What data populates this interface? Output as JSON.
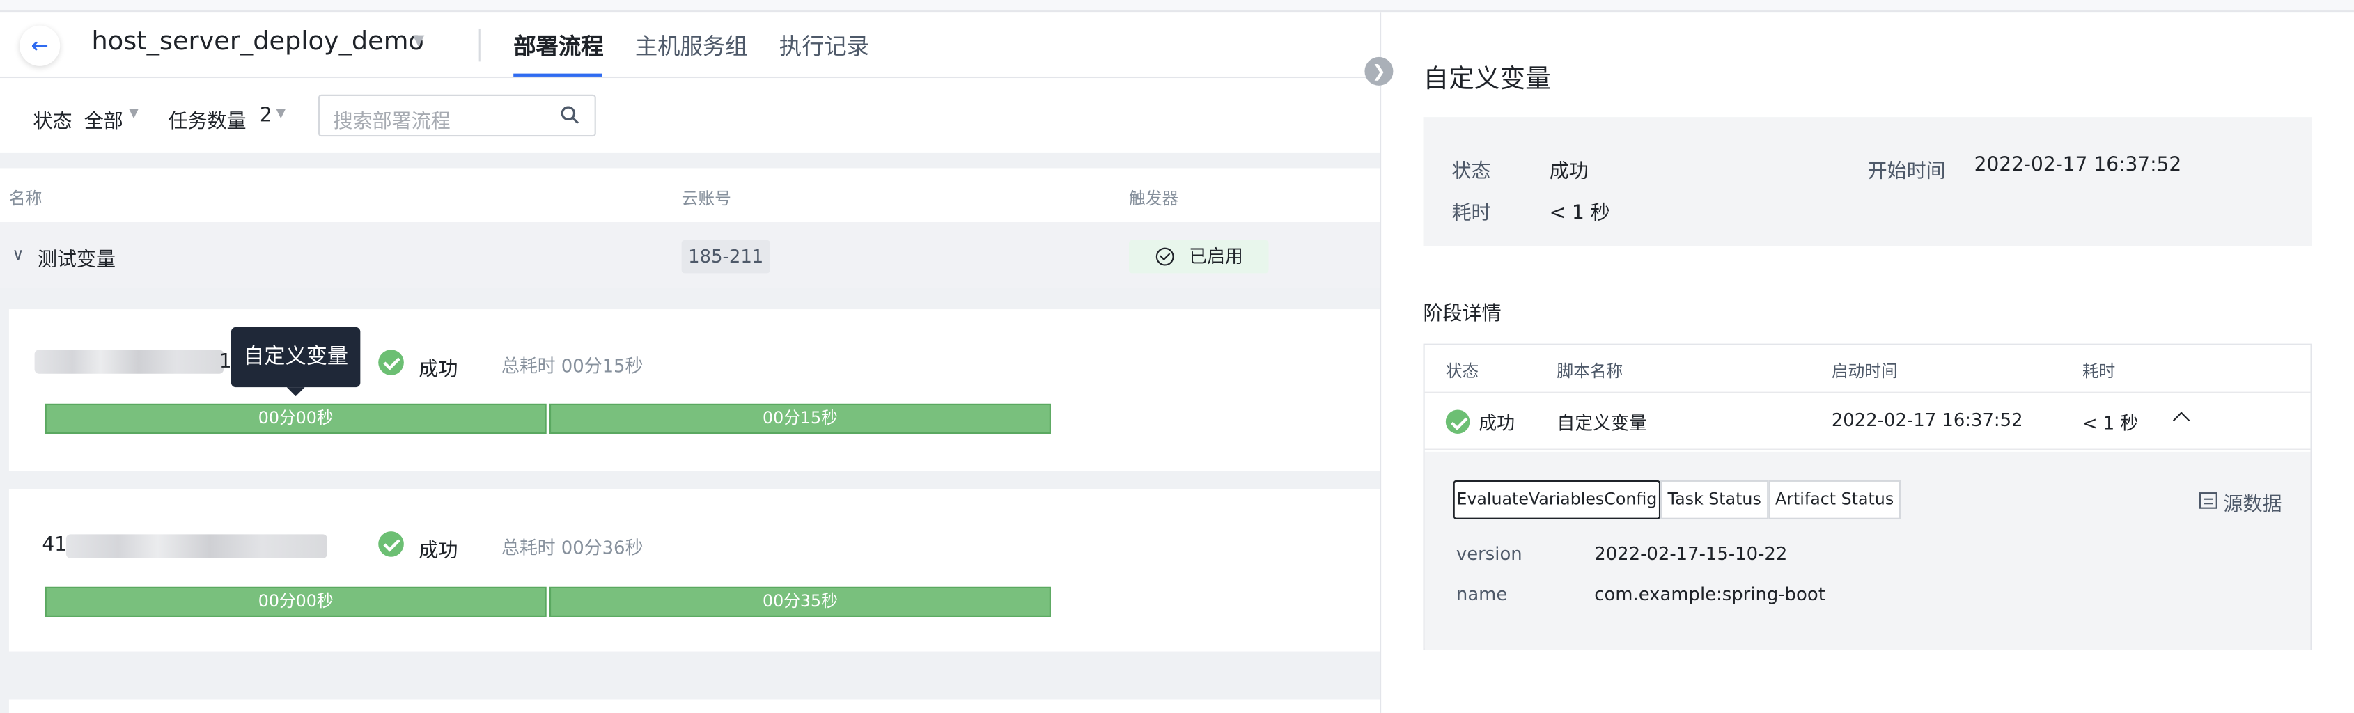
{
  "header": {
    "back_icon": "arrow-left-icon",
    "title": "host_server_deploy_demo",
    "tabs": [
      {
        "label": "部署流程",
        "active": true
      },
      {
        "label": "主机服务组",
        "active": false
      },
      {
        "label": "执行记录",
        "active": false
      }
    ]
  },
  "filters": {
    "status_label": "状态",
    "status_value": "全部",
    "task_count_label": "任务数量",
    "task_count_value": "2",
    "search_placeholder": "搜索部署流程"
  },
  "table": {
    "columns": [
      "名称",
      "云账号",
      "触发器"
    ],
    "group": {
      "name": "测试变量",
      "account": "185-211",
      "trigger": "已启用"
    }
  },
  "tooltip": "自定义变量",
  "runs": [
    {
      "id_suffix": "1",
      "status": "成功",
      "total_duration": "总耗时 00分15秒",
      "stages": [
        "00分00秒",
        "00分15秒"
      ]
    },
    {
      "id_prefix": "41",
      "status": "成功",
      "total_duration": "总耗时 00分36秒",
      "stages": [
        "00分00秒",
        "00分35秒"
      ]
    }
  ],
  "drawer": {
    "title": "自定义变量",
    "info": {
      "status_label": "状态",
      "status_value": "成功",
      "start_label": "开始时间",
      "start_value": "2022-02-17 16:37:52",
      "elapsed_label": "耗时",
      "elapsed_value": "< 1 秒"
    },
    "stage_section_title": "阶段详情",
    "stage_columns": [
      "状态",
      "脚本名称",
      "启动时间",
      "耗时"
    ],
    "stage_row": {
      "status": "成功",
      "script": "自定义变量",
      "start": "2022-02-17 16:37:52",
      "elapsed": "< 1 秒"
    },
    "detail_tabs": [
      "EvaluateVariablesConfig",
      "Task Status",
      "Artifact Status"
    ],
    "raw_data_label": "源数据",
    "kv": [
      {
        "key": "version",
        "value": "2022-02-17-15-10-22"
      },
      {
        "key": "name",
        "value": "com.example:spring-boot"
      }
    ]
  },
  "colors": {
    "accent": "#2f6bf0",
    "success": "#6cbf73",
    "bar": "#79c07d",
    "tooltip_bg": "#1f2838"
  }
}
